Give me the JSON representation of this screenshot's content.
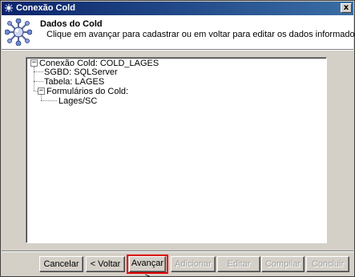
{
  "window": {
    "title": "Conexão Cold",
    "close_glyph": "x",
    "app_icon": "database-connection-icon"
  },
  "header": {
    "title": "Dados do Cold",
    "subtitle": "Clique em avançar para cadastrar ou em voltar para editar os dados informados",
    "icon": "wizard-connection-icon"
  },
  "tree": {
    "root": {
      "label": "Conexão Cold: COLD_LAGES",
      "expanded": true,
      "children": [
        {
          "label": "SGBD: SQLServer"
        },
        {
          "label": "Tabela: LAGES"
        },
        {
          "label": "Formulários do Cold:",
          "expanded": true,
          "children": [
            {
              "label": "Lages/SC"
            }
          ]
        }
      ]
    }
  },
  "buttons": {
    "cancelar": {
      "label": "Cancelar",
      "enabled": true
    },
    "voltar": {
      "label": "< Voltar",
      "enabled": true
    },
    "avancar": {
      "label": "Avançar >",
      "enabled": true,
      "highlighted": true
    },
    "adicionar": {
      "label": "Adicionar",
      "enabled": false
    },
    "editar": {
      "label": "Editar",
      "enabled": false
    },
    "compilar": {
      "label": "Compilar",
      "enabled": false
    },
    "concluir": {
      "label": "Concluir",
      "enabled": false
    }
  },
  "colors": {
    "titlebar_start": "#0a246a",
    "titlebar_end": "#3a6ea5",
    "window_bg": "#d4d0c8",
    "highlight": "#e00000"
  }
}
